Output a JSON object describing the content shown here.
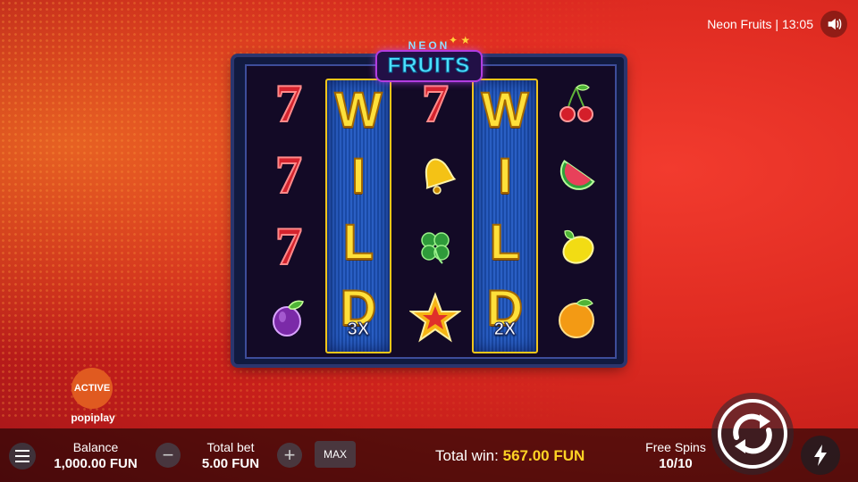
{
  "header": {
    "title": "Neon Fruits | 13:05",
    "sound_icon": "speaker-icon"
  },
  "logo": {
    "top": "NEON",
    "main": "FRUITS"
  },
  "reels": [
    [
      "seven",
      "seven",
      "seven",
      "plum"
    ],
    [
      "wild"
    ],
    [
      "seven",
      "bell",
      "clover",
      "star"
    ],
    [
      "wild"
    ],
    [
      "cherry",
      "watermelon",
      "lemon",
      "orange"
    ]
  ],
  "wild": {
    "letters": [
      "W",
      "I",
      "L",
      "D"
    ],
    "reel2_multiplier": "3X",
    "reel4_multiplier": "2X"
  },
  "status": {
    "active_label": "ACTIVE",
    "brand": "popiplay"
  },
  "bottom": {
    "balance_label": "Balance",
    "balance_value": "1,000.00 FUN",
    "bet_label": "Total bet",
    "bet_value": "5.00 FUN",
    "max_label": "MAX",
    "total_win_label": "Total win:",
    "total_win_value": "567.00 FUN",
    "free_spins_label": "Free Spins",
    "free_spins_value": "10/10"
  },
  "colors": {
    "background": "#d8281f",
    "accent": "#ffd324",
    "wild_border": "#f2c619"
  }
}
